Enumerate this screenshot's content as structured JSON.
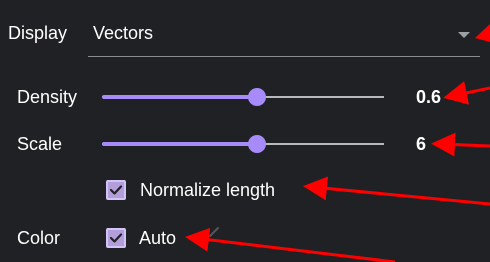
{
  "colors": {
    "panel_background": "#202124",
    "accent": "#a78bfa",
    "checkbox_fill": "#b39ddb",
    "annotation_arrow": "#ff0000"
  },
  "display": {
    "label": "Display",
    "selected": "Vectors",
    "icon": "chevron-down-icon"
  },
  "density": {
    "label": "Density",
    "value_text": "0.6",
    "fraction": 0.55
  },
  "scale": {
    "label": "Scale",
    "value_text": "6",
    "fraction": 0.55
  },
  "normalize": {
    "label": "Normalize length",
    "checked": true
  },
  "color": {
    "label": "Color",
    "auto_label": "Auto",
    "auto_checked": true
  },
  "annotations": {
    "arrow_count": 5
  }
}
